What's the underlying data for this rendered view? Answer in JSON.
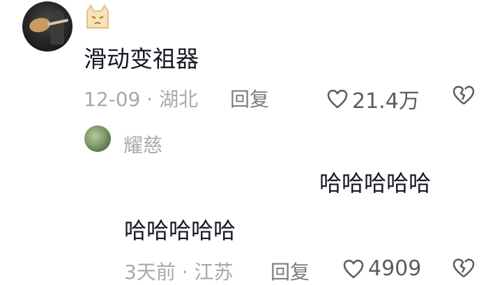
{
  "comment": {
    "username_emoji": "🐱",
    "text": "滑动变祖器",
    "date": "12-09",
    "separator": "·",
    "location": "湖北",
    "reply_label": "回复",
    "like_count": "21.4万"
  },
  "sub_comment": {
    "username": "耀慈",
    "quoted_text": "哈哈哈哈哈",
    "text": "哈哈哈哈哈",
    "date": "3天前",
    "separator": "·",
    "location": "江苏",
    "reply_label": "回复",
    "like_count": "4909"
  },
  "colors": {
    "text_primary": "#161823",
    "text_meta": "#a8a9ad",
    "icon_gray": "#5b5c61"
  }
}
